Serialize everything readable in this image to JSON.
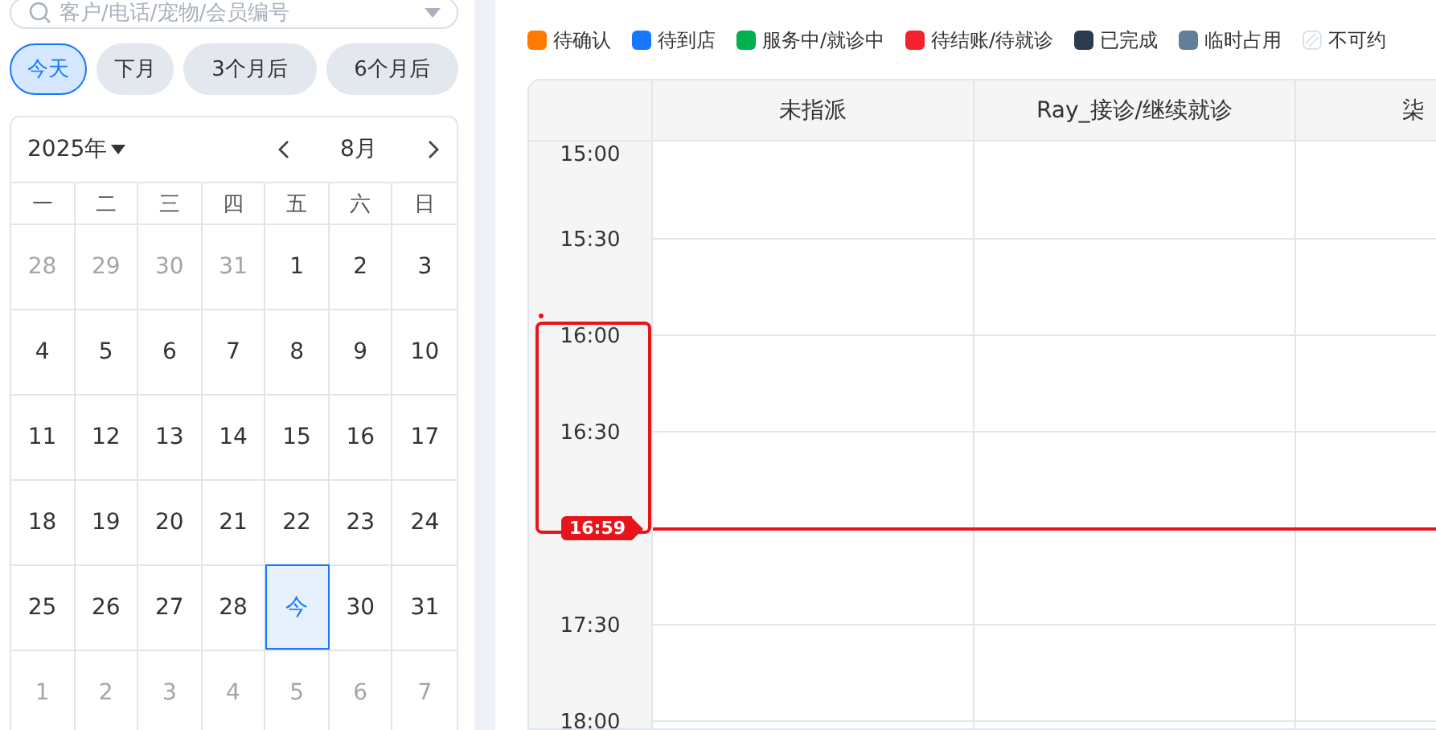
{
  "search": {
    "placeholder": "客户/电话/宠物/会员编号"
  },
  "quick_ranges": [
    {
      "label": "今天",
      "selected": true
    },
    {
      "label": "下月",
      "selected": false
    },
    {
      "label": "3个月后",
      "selected": false
    },
    {
      "label": "6个月后",
      "selected": false
    }
  ],
  "calendar": {
    "year": "2025年",
    "month": "8月",
    "weekdays": [
      "一",
      "二",
      "三",
      "四",
      "五",
      "六",
      "日"
    ],
    "days": [
      {
        "label": "28",
        "muted": true,
        "selected": false
      },
      {
        "label": "29",
        "muted": true,
        "selected": false
      },
      {
        "label": "30",
        "muted": true,
        "selected": false
      },
      {
        "label": "31",
        "muted": true,
        "selected": false
      },
      {
        "label": "1",
        "muted": false,
        "selected": false
      },
      {
        "label": "2",
        "muted": false,
        "selected": false
      },
      {
        "label": "3",
        "muted": false,
        "selected": false
      },
      {
        "label": "4",
        "muted": false,
        "selected": false
      },
      {
        "label": "5",
        "muted": false,
        "selected": false
      },
      {
        "label": "6",
        "muted": false,
        "selected": false
      },
      {
        "label": "7",
        "muted": false,
        "selected": false
      },
      {
        "label": "8",
        "muted": false,
        "selected": false
      },
      {
        "label": "9",
        "muted": false,
        "selected": false
      },
      {
        "label": "10",
        "muted": false,
        "selected": false
      },
      {
        "label": "11",
        "muted": false,
        "selected": false
      },
      {
        "label": "12",
        "muted": false,
        "selected": false
      },
      {
        "label": "13",
        "muted": false,
        "selected": false
      },
      {
        "label": "14",
        "muted": false,
        "selected": false
      },
      {
        "label": "15",
        "muted": false,
        "selected": false
      },
      {
        "label": "16",
        "muted": false,
        "selected": false
      },
      {
        "label": "17",
        "muted": false,
        "selected": false
      },
      {
        "label": "18",
        "muted": false,
        "selected": false
      },
      {
        "label": "19",
        "muted": false,
        "selected": false
      },
      {
        "label": "20",
        "muted": false,
        "selected": false
      },
      {
        "label": "21",
        "muted": false,
        "selected": false
      },
      {
        "label": "22",
        "muted": false,
        "selected": false
      },
      {
        "label": "23",
        "muted": false,
        "selected": false
      },
      {
        "label": "24",
        "muted": false,
        "selected": false
      },
      {
        "label": "25",
        "muted": false,
        "selected": false
      },
      {
        "label": "26",
        "muted": false,
        "selected": false
      },
      {
        "label": "27",
        "muted": false,
        "selected": false
      },
      {
        "label": "28",
        "muted": false,
        "selected": false
      },
      {
        "label": "今",
        "muted": false,
        "selected": true
      },
      {
        "label": "30",
        "muted": false,
        "selected": false
      },
      {
        "label": "31",
        "muted": false,
        "selected": false
      },
      {
        "label": "1",
        "muted": true,
        "selected": false
      },
      {
        "label": "2",
        "muted": true,
        "selected": false
      },
      {
        "label": "3",
        "muted": true,
        "selected": false
      },
      {
        "label": "4",
        "muted": true,
        "selected": false
      },
      {
        "label": "5",
        "muted": true,
        "selected": false
      },
      {
        "label": "6",
        "muted": true,
        "selected": false
      },
      {
        "label": "7",
        "muted": true,
        "selected": false
      }
    ]
  },
  "legend": [
    {
      "label": "待确认",
      "kind": "solid",
      "color": "#ff7a00"
    },
    {
      "label": "待到店",
      "kind": "solid",
      "color": "#1677ff"
    },
    {
      "label": "服务中/就诊中",
      "kind": "solid",
      "color": "#00b14f"
    },
    {
      "label": "待结账/待就诊",
      "kind": "solid",
      "color": "#f5222d"
    },
    {
      "label": "已完成",
      "kind": "solid",
      "color": "#2c3a4f"
    },
    {
      "label": "临时占用",
      "kind": "solid",
      "color": "#60809a"
    },
    {
      "label": "不可约",
      "kind": "hatched",
      "color": "#dbe3ec"
    }
  ],
  "schedule": {
    "columns": [
      "未指派",
      "Ray_接诊/继续就诊",
      "柒"
    ],
    "time_slots": [
      {
        "label": "15:00",
        "highlighted": false
      },
      {
        "label": "15:30",
        "highlighted": false
      },
      {
        "label": "16:00",
        "highlighted": true
      },
      {
        "label": "16:30",
        "highlighted": true
      },
      {
        "now_label": "16:59"
      },
      {
        "label": "17:30",
        "highlighted": false
      },
      {
        "label": "18:00",
        "highlighted": false
      }
    ]
  }
}
